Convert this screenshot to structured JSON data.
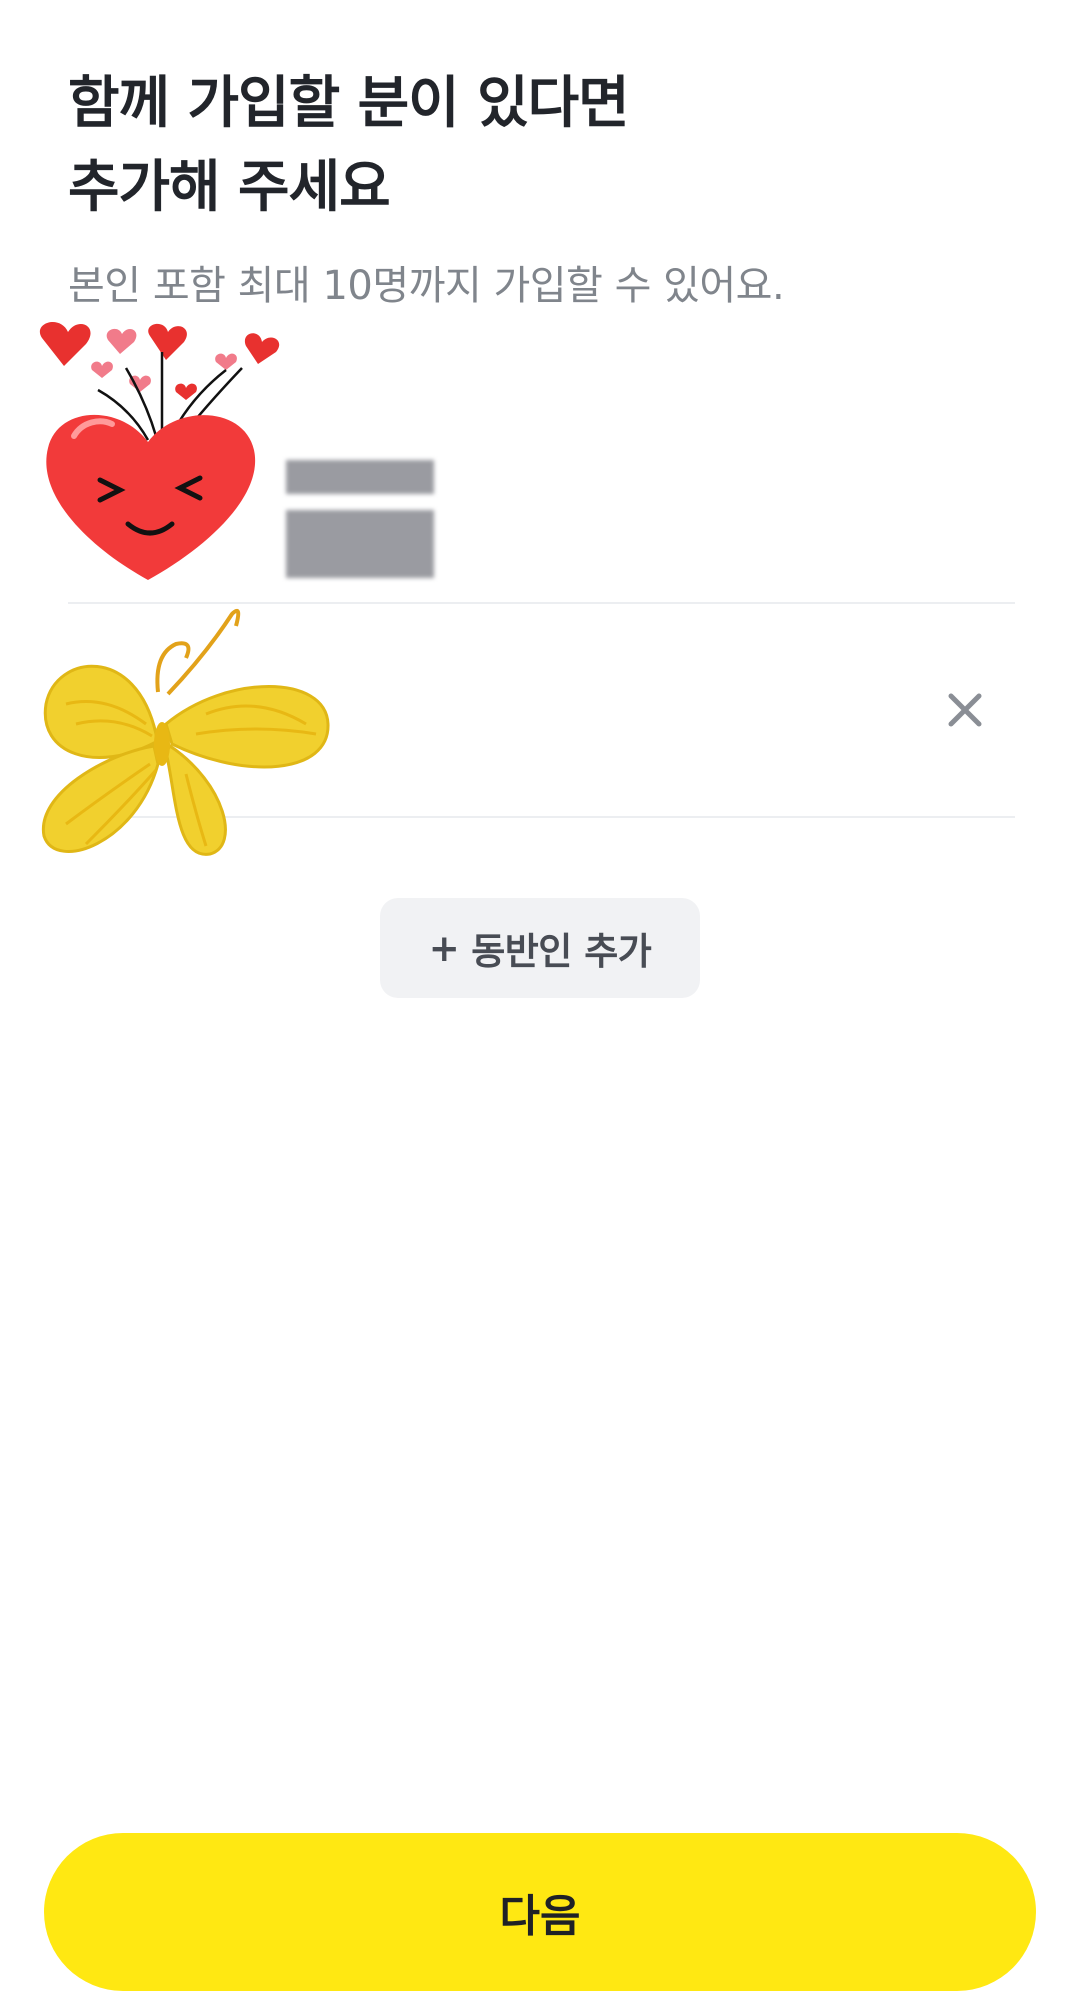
{
  "header": {
    "title_line1": "함께 가입할 분이 있다면",
    "title_line2": "추가해 주세요",
    "subtitle": "본인 포함 최대 10명까지 가입할 수 있어요."
  },
  "members": [
    {
      "name": "",
      "removable": false
    },
    {
      "name": "",
      "removable": true,
      "remove_icon": "close-icon"
    }
  ],
  "add_button": {
    "plus": "+",
    "label": "동반인 추가"
  },
  "next_button": {
    "label": "다음"
  },
  "colors": {
    "accent": "#ffe812",
    "title": "#22252b",
    "subtitle": "#80858c",
    "divider": "#eceef1",
    "secondary_button": "#f1f2f4"
  },
  "stickers": [
    "heart-sticker",
    "butterfly-sticker"
  ]
}
